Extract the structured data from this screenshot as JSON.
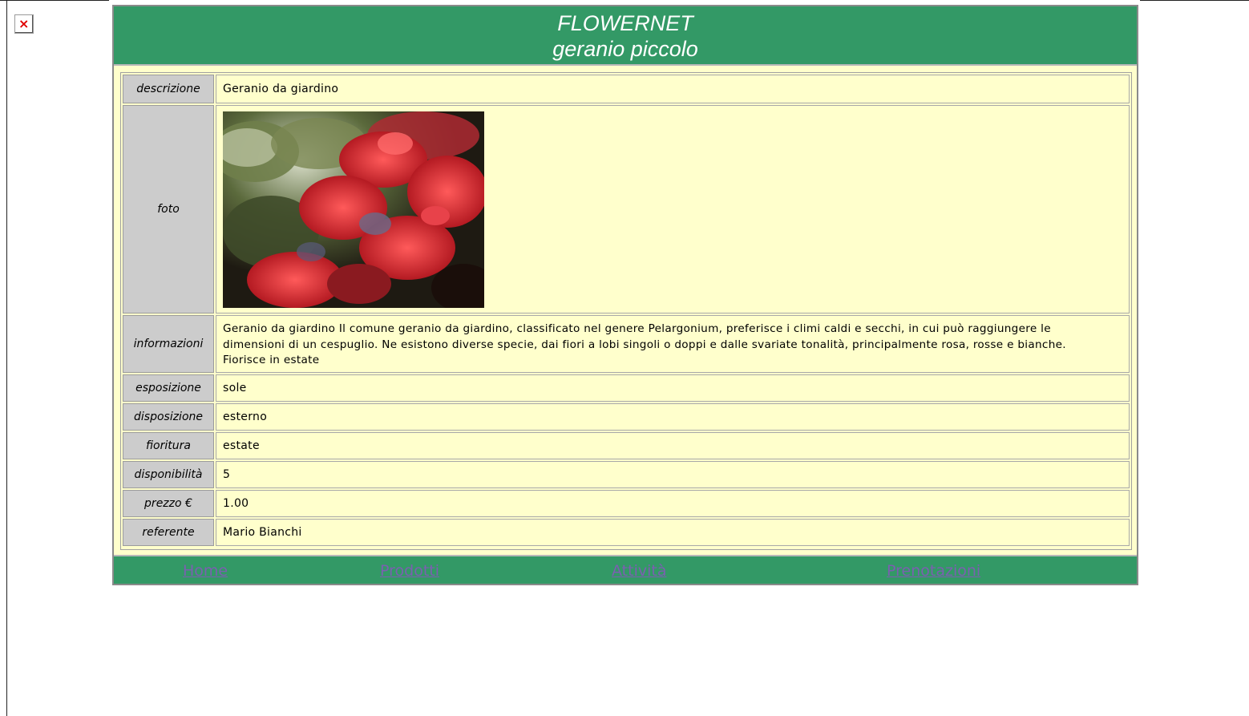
{
  "header": {
    "site_name": "FLOWERNET",
    "product_name": "geranio piccolo"
  },
  "broken_image_icon": "broken-image-icon",
  "details": {
    "descrizione": {
      "label": "descrizione",
      "value": "Geranio da giardino"
    },
    "foto": {
      "label": "foto",
      "alt": "geranio piccolo"
    },
    "informazioni": {
      "label": "informazioni",
      "value": "Geranio da giardino Il comune geranio da giardino, classificato nel genere Pelargonium, preferisce i climi caldi e secchi, in cui può raggiungere le dimensioni di un cespuglio. Ne esistono diverse specie, dai fiori a lobi singoli o doppi e dalle svariate tonalità, principalmente rosa, rosse e bianche. Fiorisce in estate"
    },
    "esposizione": {
      "label": "esposizione",
      "value": "sole"
    },
    "disposizione": {
      "label": "disposizione",
      "value": "esterno"
    },
    "fioritura": {
      "label": "fioritura",
      "value": "estate"
    },
    "disponibilita": {
      "label": "disponibilità",
      "value": "5"
    },
    "prezzo": {
      "label": "prezzo €",
      "value": "1.00"
    },
    "referente": {
      "label": "referente",
      "value": "Mario Bianchi"
    }
  },
  "footer": {
    "links": [
      {
        "label": "Home"
      },
      {
        "label": "Prodotti"
      },
      {
        "label": "Attività"
      },
      {
        "label": "Prenotazioni"
      }
    ]
  },
  "colors": {
    "header_bg": "#339966",
    "content_bg": "#ffffcc",
    "label_bg": "#cccccc",
    "link": "#7b5fb0"
  }
}
